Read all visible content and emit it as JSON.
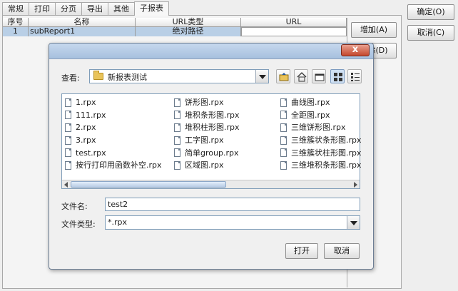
{
  "tabs": [
    "常规",
    "打印",
    "分页",
    "导出",
    "其他",
    "子报表"
  ],
  "active_tab": 5,
  "grid": {
    "headers": [
      "序号",
      "名称",
      "URL类型",
      "URL"
    ],
    "rows": [
      {
        "index": "1",
        "name": "subReport1",
        "url_type": "绝对路径",
        "url": ""
      }
    ]
  },
  "buttons": {
    "add": "增加(A)",
    "delete": "删除(D)",
    "ok": "确定(O)",
    "cancel": "取消(C)"
  },
  "dialog": {
    "close_glyph": "x",
    "look_in_label": "查看:",
    "look_in_value": "新报表测试",
    "files_col1": [
      "1.rpx",
      "111.rpx",
      "2.rpx",
      "3.rpx",
      "test.rpx",
      "按行打印用函数补空.rpx"
    ],
    "files_col2": [
      "饼形图.rpx",
      "堆积条形图.rpx",
      "堆积柱形图.rpx",
      "工字图.rpx",
      "简单group.rpx",
      "区域图.rpx"
    ],
    "files_col3": [
      "曲线图.rpx",
      "全距图.rpx",
      "三维饼形图.rpx",
      "三维簇状条形图.rpx",
      "三维簇状柱形图.rpx",
      "三维堆积条形图.rpx"
    ],
    "filename_label": "文件名:",
    "filename_value": "test2",
    "filetype_label": "文件类型:",
    "filetype_value": "*.rpx",
    "open_button": "打开",
    "cancel_button": "取消"
  }
}
